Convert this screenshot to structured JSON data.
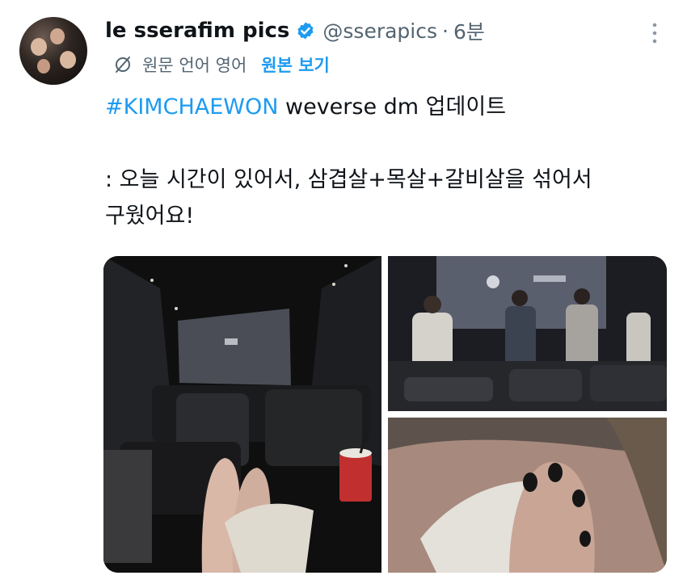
{
  "author": {
    "display_name": "le sserafim pics",
    "handle": "@sserapics",
    "separator": "·",
    "time": "6분",
    "verified": true,
    "avatar_icon": "group-photo-avatar"
  },
  "translation": {
    "icon": "translate-slash-icon",
    "label": "원문 언어 영어",
    "link_label": "원본 보기"
  },
  "tweet": {
    "hashtag": "#KIMCHAEWON",
    "line1_rest": " weverse dm 업데이트",
    "line2": ": 오늘 시간이 있어서, 삼겹살+목살+갈비살을 섞어서",
    "line3": "구웠어요!"
  },
  "media": [
    {
      "name": "movie-theater-seat-photo"
    },
    {
      "name": "theater-screen-audience-photo"
    },
    {
      "name": "face-covered-hand-photo"
    }
  ],
  "colors": {
    "link": "#1d9bf0",
    "text": "#0f1419",
    "secondary": "#536471",
    "verified": "#1d9bf0"
  }
}
